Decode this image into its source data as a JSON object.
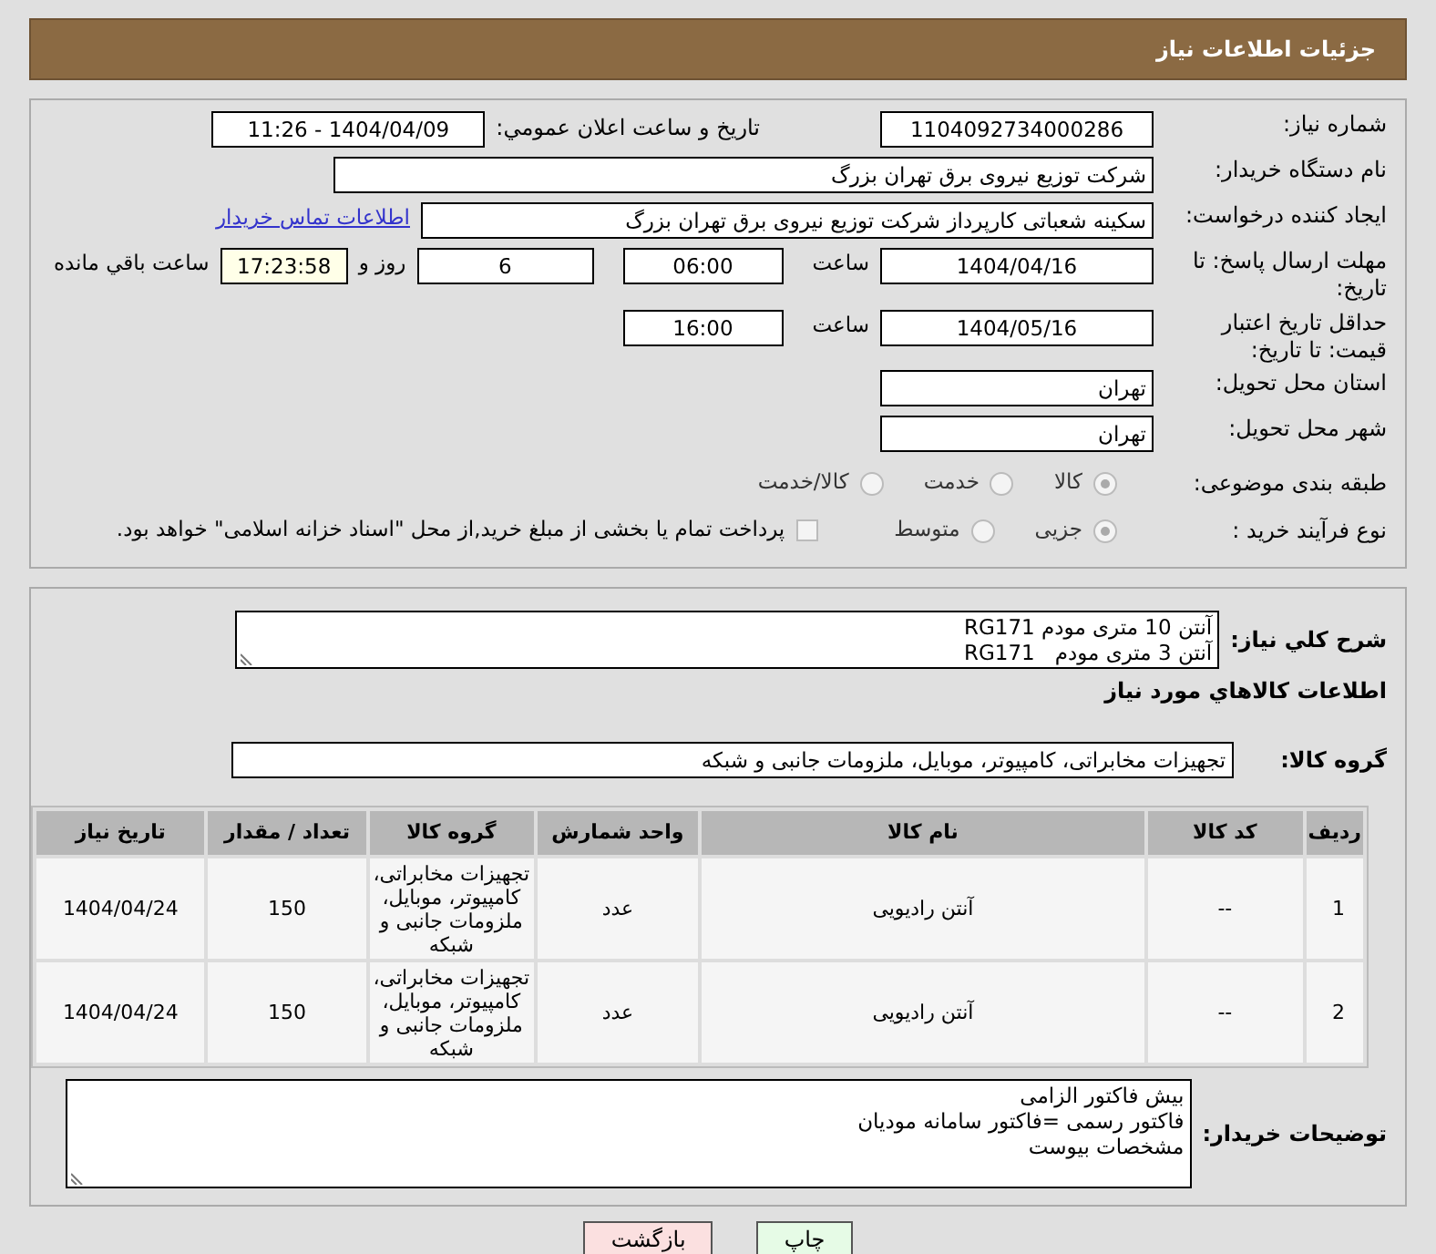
{
  "header": {
    "title": "جزئیات اطلاعات نیاز"
  },
  "fields": {
    "need_number": {
      "label": "شماره نیاز:",
      "value": "1104092734000286"
    },
    "announce": {
      "label": "تاریخ و ساعت اعلان عمومي:",
      "value": "1404/04/09 - 11:26"
    },
    "buyer": {
      "label": "نام دستگاه خریدار:",
      "value": "شرکت توزیع نیروی برق تهران بزرگ"
    },
    "creator": {
      "label": "ایجاد کننده درخواست:",
      "value": "سکینه شعباتی کارپرداز شرکت توزیع نیروی برق تهران بزرگ",
      "link": "اطلاعات تماس خریدار"
    },
    "deadline": {
      "label": "مهلت ارسال پاسخ: تا تاریخ:",
      "date": "1404/04/16",
      "time_label": "ساعت",
      "time": "06:00",
      "days": "6",
      "days_label": "روز و",
      "remaining": "17:23:58",
      "remaining_label": "ساعت باقي مانده"
    },
    "validity": {
      "label": "حداقل تاریخ اعتبار قیمت: تا تاریخ:",
      "date": "1404/05/16",
      "time_label": "ساعت",
      "time": "16:00"
    },
    "province": {
      "label": "استان محل تحویل:",
      "value": "تهران"
    },
    "city": {
      "label": "شهر محل تحویل:",
      "value": "تهران"
    },
    "category": {
      "label": "طبقه بندی موضوعی:",
      "options": [
        {
          "label": "کالا",
          "selected": true
        },
        {
          "label": "خدمت",
          "selected": false
        },
        {
          "label": "کالا/خدمت",
          "selected": false
        }
      ]
    },
    "process": {
      "label": "نوع فرآیند خرید :",
      "options": [
        {
          "label": "جزیی",
          "selected": true
        },
        {
          "label": "متوسط",
          "selected": false
        }
      ],
      "treasury": {
        "label": "پرداخت تمام یا بخشی از مبلغ خرید,از محل \"اسناد خزانه اسلامی\" خواهد بود.",
        "checked": false
      }
    }
  },
  "description": {
    "label": "شرح کلي نیاز:",
    "lines": [
      "آنتن 10 متری مودم RG171",
      "آنتن 3 متری مودم   RG171"
    ]
  },
  "goods_heading": "اطلاعات کالاهاي مورد نیاز",
  "goods_group": {
    "label": "گروه کالا:",
    "value": "تجهیزات مخابراتی، کامپیوتر، موبایل، ملزومات جانبی و شبکه"
  },
  "table": {
    "columns": [
      "ردیف",
      "کد کالا",
      "نام کالا",
      "واحد شمارش",
      "گروه کالا",
      "تعداد / مقدار",
      "تاریخ نیاز"
    ],
    "rows": [
      [
        "1",
        "--",
        "آنتن رادیویی",
        "عدد",
        "تجهیزات مخابراتی، کامپیوتر، موبایل، ملزومات جانبی و شبکه",
        "150",
        "1404/04/24"
      ],
      [
        "2",
        "--",
        "آنتن رادیویی",
        "عدد",
        "تجهیزات مخابراتی، کامپیوتر، موبایل، ملزومات جانبی و شبکه",
        "150",
        "1404/04/24"
      ]
    ]
  },
  "buyer_notes": {
    "label": "توضیحات خریدار:",
    "lines": [
      "بیش فاکتور الزامی",
      "فاکتور رسمی =فاکتور سامانه مودیان",
      "مشخصات بیوست"
    ]
  },
  "buttons": [
    {
      "label": "چاپ",
      "kind": "print"
    },
    {
      "label": "بازگشت",
      "kind": "back"
    }
  ]
}
